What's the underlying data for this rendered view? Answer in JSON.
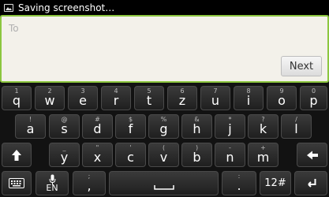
{
  "status_bar": {
    "icon": "image-icon",
    "text": "Saving screenshot…"
  },
  "compose": {
    "to_placeholder": "To",
    "next_label": "Next"
  },
  "keyboard": {
    "row1": [
      {
        "main": "q",
        "alt": "1"
      },
      {
        "main": "w",
        "alt": "2"
      },
      {
        "main": "e",
        "alt": "3"
      },
      {
        "main": "r",
        "alt": "4"
      },
      {
        "main": "t",
        "alt": "5"
      },
      {
        "main": "z",
        "alt": "6"
      },
      {
        "main": "u",
        "alt": "7"
      },
      {
        "main": "i",
        "alt": "8"
      },
      {
        "main": "o",
        "alt": "9"
      },
      {
        "main": "p",
        "alt": "0"
      }
    ],
    "row2": [
      {
        "main": "a",
        "alt": "!"
      },
      {
        "main": "s",
        "alt": "@"
      },
      {
        "main": "d",
        "alt": "#"
      },
      {
        "main": "f",
        "alt": "$"
      },
      {
        "main": "g",
        "alt": "%"
      },
      {
        "main": "h",
        "alt": "&"
      },
      {
        "main": "j",
        "alt": "*"
      },
      {
        "main": "k",
        "alt": "?"
      },
      {
        "main": "l",
        "alt": "/"
      }
    ],
    "row3": [
      {
        "main": "y",
        "alt": "_"
      },
      {
        "main": "x",
        "alt": "\""
      },
      {
        "main": "c",
        "alt": "'"
      },
      {
        "main": "v",
        "alt": "("
      },
      {
        "main": "b",
        "alt": ")"
      },
      {
        "main": "n",
        "alt": "-"
      },
      {
        "main": "m",
        "alt": "+"
      }
    ],
    "lang_label": "EN",
    "comma_main": ",",
    "comma_alt": ";",
    "period_main": ".",
    "period_alt": ":",
    "symbols_label": "12#",
    "icons": {
      "shift": "shift-arrow-icon",
      "backspace": "backspace-arrow-icon",
      "keyboard": "keyboard-icon",
      "mic": "microphone-icon",
      "space": "space-bar-icon",
      "enter": "enter-icon"
    }
  }
}
